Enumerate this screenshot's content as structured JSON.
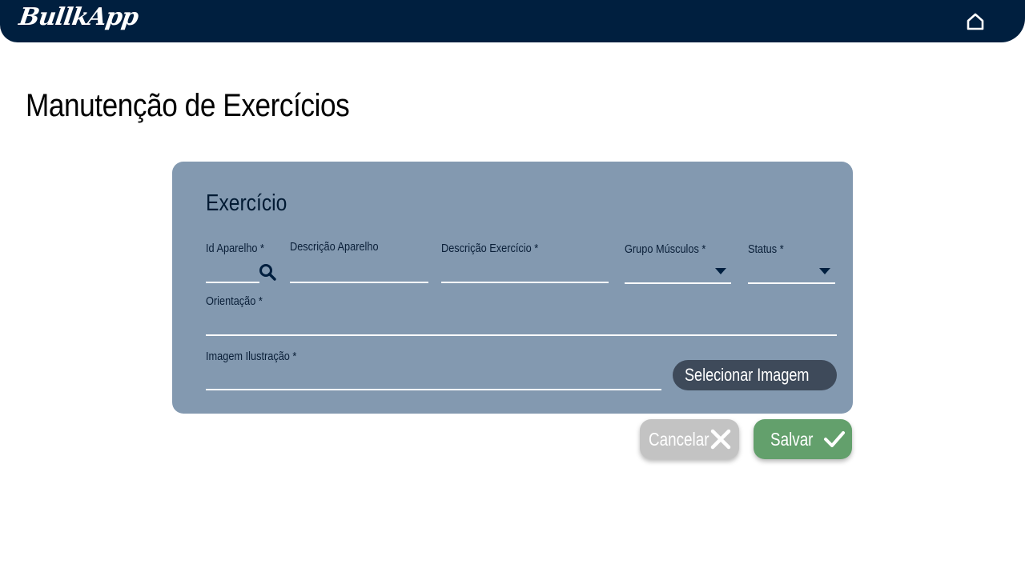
{
  "app": {
    "logo_text": "BullkApp"
  },
  "header": {
    "home_icon": "home-icon"
  },
  "page": {
    "title": "Manutenção de Exercícios"
  },
  "form": {
    "section_title": "Exercício",
    "fields": {
      "id_aparelho": {
        "label": "Id Aparelho *",
        "value": ""
      },
      "descricao_aparelho": {
        "label": "Descrição Aparelho",
        "value": ""
      },
      "descricao_exercicio": {
        "label": "Descrição Exercício *",
        "value": ""
      },
      "grupo_musculos": {
        "label": "Grupo Músculos *",
        "value": ""
      },
      "status": {
        "label": "Status *",
        "value": ""
      },
      "orientacao": {
        "label": "Orientação *",
        "value": ""
      },
      "imagem_ilustracao": {
        "label": "Imagem Ilustração *",
        "value": ""
      }
    },
    "upload_label": "Selecionar Imagem"
  },
  "actions": {
    "cancel_label": "Cancelar",
    "save_label": "Salvar"
  },
  "colors": {
    "header_bg": "#001f3f",
    "card_bg": "#8399b0",
    "upload_bg": "#3e4a5a",
    "cancel_bg": "#c3c3c3",
    "save_bg": "#63a06c"
  }
}
